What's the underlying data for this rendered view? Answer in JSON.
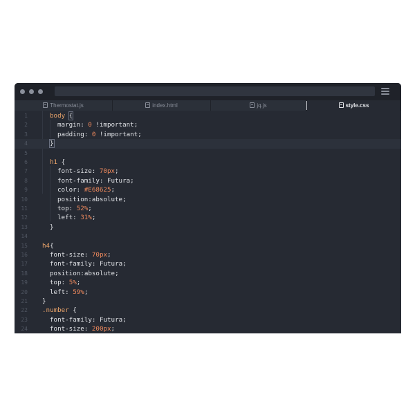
{
  "window": {
    "tabs": [
      {
        "label": "Thermostat.js",
        "icon": "file-js-icon",
        "active": false
      },
      {
        "label": "index.html",
        "icon": "file-html-icon",
        "active": false
      },
      {
        "label": "jq.js",
        "icon": "file-js-icon",
        "active": false
      },
      {
        "label": "style.css",
        "icon": "file-css-icon",
        "active": true
      }
    ]
  },
  "editor": {
    "current_line": 4,
    "lines": [
      {
        "n": "1",
        "indent": 1,
        "tokens": [
          [
            "sel",
            "body"
          ],
          [
            "punc",
            " "
          ],
          [
            "brace",
            "{"
          ]
        ]
      },
      {
        "n": "2",
        "indent": 2,
        "tokens": [
          [
            "prop",
            "margin"
          ],
          [
            "punc",
            ": "
          ],
          [
            "num",
            "0"
          ],
          [
            "val",
            " !important"
          ],
          [
            "punc",
            ";"
          ]
        ]
      },
      {
        "n": "3",
        "indent": 2,
        "tokens": [
          [
            "prop",
            "padding"
          ],
          [
            "punc",
            ": "
          ],
          [
            "num",
            "0"
          ],
          [
            "val",
            " !important"
          ],
          [
            "punc",
            ";"
          ]
        ]
      },
      {
        "n": "4",
        "indent": 1,
        "tokens": [
          [
            "brace",
            "}"
          ]
        ]
      },
      {
        "n": "5",
        "indent": 0,
        "tokens": []
      },
      {
        "n": "6",
        "indent": 1,
        "tokens": [
          [
            "sel",
            "h1"
          ],
          [
            "punc",
            " {"
          ]
        ]
      },
      {
        "n": "7",
        "indent": 2,
        "tokens": [
          [
            "prop",
            "font-size"
          ],
          [
            "punc",
            ": "
          ],
          [
            "num",
            "70px"
          ],
          [
            "punc",
            ";"
          ]
        ]
      },
      {
        "n": "8",
        "indent": 2,
        "tokens": [
          [
            "prop",
            "font-family"
          ],
          [
            "punc",
            ": "
          ],
          [
            "val",
            "Futura"
          ],
          [
            "punc",
            ";"
          ]
        ]
      },
      {
        "n": "9",
        "indent": 2,
        "tokens": [
          [
            "prop",
            "color"
          ],
          [
            "punc",
            ": "
          ],
          [
            "hex",
            "#E68625"
          ],
          [
            "punc",
            ";"
          ]
        ]
      },
      {
        "n": "10",
        "indent": 2,
        "tokens": [
          [
            "prop",
            "position"
          ],
          [
            "punc",
            ":"
          ],
          [
            "val",
            "absolute"
          ],
          [
            "punc",
            ";"
          ]
        ]
      },
      {
        "n": "11",
        "indent": 2,
        "tokens": [
          [
            "prop",
            "top"
          ],
          [
            "punc",
            ": "
          ],
          [
            "num",
            "52%"
          ],
          [
            "punc",
            ";"
          ]
        ]
      },
      {
        "n": "12",
        "indent": 2,
        "tokens": [
          [
            "prop",
            "left"
          ],
          [
            "punc",
            ": "
          ],
          [
            "num",
            "31%"
          ],
          [
            "punc",
            ";"
          ]
        ]
      },
      {
        "n": "13",
        "indent": 1,
        "tokens": [
          [
            "punc",
            "}"
          ]
        ]
      },
      {
        "n": "14",
        "indent": 0,
        "tokens": []
      },
      {
        "n": "15",
        "indent": 0,
        "tokens": [
          [
            "sel",
            "h4"
          ],
          [
            "punc",
            "{"
          ]
        ]
      },
      {
        "n": "16",
        "indent": 1,
        "tokens": [
          [
            "prop",
            "font-size"
          ],
          [
            "punc",
            ": "
          ],
          [
            "num",
            "70px"
          ],
          [
            "punc",
            ";"
          ]
        ]
      },
      {
        "n": "17",
        "indent": 1,
        "tokens": [
          [
            "prop",
            "font-family"
          ],
          [
            "punc",
            ": "
          ],
          [
            "val",
            "Futura"
          ],
          [
            "punc",
            ";"
          ]
        ]
      },
      {
        "n": "18",
        "indent": 1,
        "tokens": [
          [
            "prop",
            "position"
          ],
          [
            "punc",
            ":"
          ],
          [
            "val",
            "absolute"
          ],
          [
            "punc",
            ";"
          ]
        ]
      },
      {
        "n": "19",
        "indent": 1,
        "tokens": [
          [
            "prop",
            "top"
          ],
          [
            "punc",
            ": "
          ],
          [
            "num",
            "5%"
          ],
          [
            "punc",
            ";"
          ]
        ]
      },
      {
        "n": "20",
        "indent": 1,
        "tokens": [
          [
            "prop",
            "left"
          ],
          [
            "punc",
            ": "
          ],
          [
            "num",
            "59%"
          ],
          [
            "punc",
            ";"
          ]
        ]
      },
      {
        "n": "21",
        "indent": 0,
        "tokens": [
          [
            "punc",
            "}"
          ]
        ]
      },
      {
        "n": "22",
        "indent": 0,
        "tokens": [
          [
            "sel",
            ".number"
          ],
          [
            "punc",
            " {"
          ]
        ]
      },
      {
        "n": "23",
        "indent": 1,
        "tokens": [
          [
            "prop",
            "font-family"
          ],
          [
            "punc",
            ": "
          ],
          [
            "val",
            "Futura"
          ],
          [
            "punc",
            ";"
          ]
        ]
      },
      {
        "n": "24",
        "indent": 1,
        "tokens": [
          [
            "prop",
            "font-size"
          ],
          [
            "punc",
            ": "
          ],
          [
            "num",
            "200px"
          ],
          [
            "punc",
            ";"
          ]
        ]
      }
    ]
  },
  "colors": {
    "selector": "#e8a36a",
    "number": "#f08a5d",
    "text": "#e0e2e6",
    "background": "#262a33",
    "chrome": "#1f2229"
  }
}
